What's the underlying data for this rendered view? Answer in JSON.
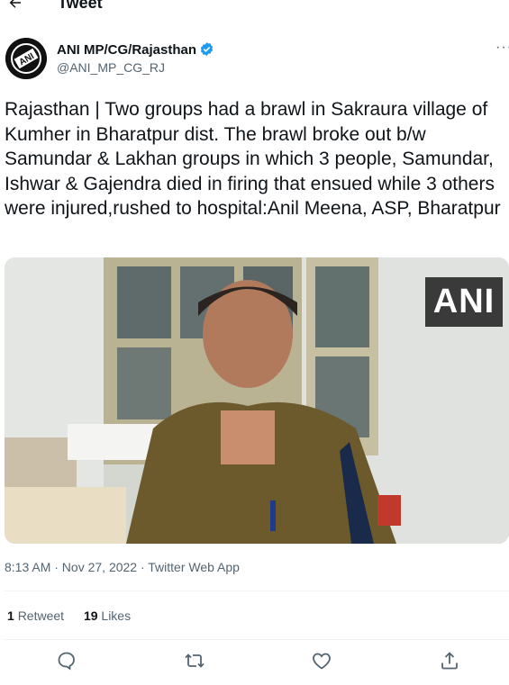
{
  "header": {
    "title": "Tweet"
  },
  "author": {
    "name": "ANI MP/CG/Rajasthan",
    "handle": "@ANI_MP_CG_RJ",
    "avatar_text": "ANI"
  },
  "tweet": {
    "text": "Rajasthan | Two groups had a brawl in Sakraura village of Kumher in Bharatpur dist. The brawl broke out b/w Samundar & Lakhan groups in which 3 people, Samundar, Ishwar & Gajendra died in firing that ensued while 3 others were injured,rushed to hospital:Anil Meena, ASP, Bharatpur",
    "media_watermark": "ANI",
    "timestamp": "8:13 AM · Nov 27, 2022 · Twitter Web App"
  },
  "stats": {
    "retweet_count": "1",
    "retweet_label": "Retweet",
    "like_count": "19",
    "like_label": "Likes"
  },
  "actions": [
    "reply-icon",
    "retweet-icon",
    "like-icon",
    "share-icon"
  ],
  "colors": {
    "accent": "#1d9bf0",
    "secondary_text": "#536471",
    "divider": "#eff3f4"
  }
}
